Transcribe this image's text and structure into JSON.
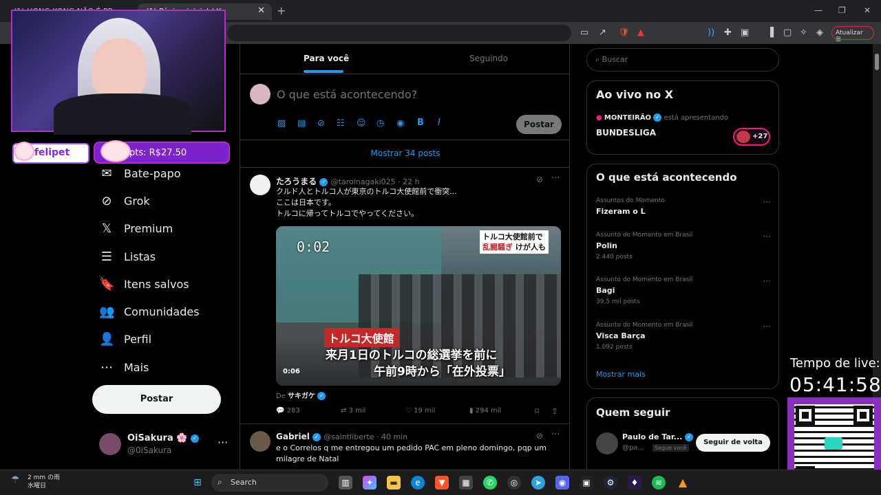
{
  "browser": {
    "tabs": [
      {
        "label": "(1) HONG KONG NÃO É PR..."
      },
      {
        "label": "(1) Página inicial / X"
      }
    ],
    "new_tab": "+",
    "window_controls": {
      "minimize": "—",
      "maximize": "❐",
      "close": "✕"
    },
    "update_button": "Atualizar"
  },
  "stream": {
    "name_badge": "vtfelipet",
    "points_badge": "pts: R$27.50",
    "live_time_label": "Tempo de live:",
    "live_time_value": "05:41:58"
  },
  "nav": {
    "items": [
      {
        "icon": "chat-icon",
        "glyph": "✉",
        "label": "Bate-papo"
      },
      {
        "icon": "grok-icon",
        "glyph": "⊘",
        "label": "Grok"
      },
      {
        "icon": "x-logo-icon",
        "glyph": "𝕏",
        "label": "Premium"
      },
      {
        "icon": "list-icon",
        "glyph": "☰",
        "label": "Listas"
      },
      {
        "icon": "bookmark-icon",
        "glyph": "🔖",
        "label": "Itens salvos"
      },
      {
        "icon": "communities-icon",
        "glyph": "👥",
        "label": "Comunidades"
      },
      {
        "icon": "profile-icon",
        "glyph": "👤",
        "label": "Perfil"
      },
      {
        "icon": "more-icon",
        "glyph": "⋯",
        "label": "Mais"
      }
    ],
    "post_button": "Postar",
    "account": {
      "name": "OiSakura",
      "star": "🌸",
      "handle": "@0iSakura",
      "more": "···"
    }
  },
  "feed": {
    "tabs": [
      {
        "label": "Para você"
      },
      {
        "label": "Seguindo"
      }
    ],
    "composer": {
      "placeholder": "O que está acontecendo?",
      "post_button": "Postar"
    },
    "show_more": "Mostrar 34 posts",
    "tweets": [
      {
        "name": "たろうまる",
        "handle": "@taroinagaki025 · 22 h",
        "lines": [
          "クルド人とトルコ人が東京のトルコ大使館前で衝突...",
          "ここは日本です。",
          "トルコに帰ってトルコでやってください。"
        ],
        "video": {
          "timestamp": "0:02",
          "top_caption_1": "トルコ大使館前で",
          "top_caption_2a": "乱闘騒ぎ",
          "top_caption_2b": " けが人も",
          "caption_red": "トルコ大使館",
          "caption_line1": "来月1日のトルコの総選挙を前に",
          "caption_line2": "午前9時から「在外投票」",
          "duration": "0:06"
        },
        "source_prefix": "De",
        "source_name": "サキガケ",
        "stats": {
          "replies": "283",
          "reposts": "3 mil",
          "likes": "19 mil",
          "views": "294 mil"
        }
      },
      {
        "name": "Gabriel",
        "handle": "@saintliberte · 40 min",
        "lines": [
          "e o Correlos q me entregou um pedido PAC em pleno domingo, pqp um",
          "milagre de Natal"
        ]
      }
    ]
  },
  "sidebar": {
    "search_placeholder": "Buscar",
    "live": {
      "heading": "Ao vivo no X",
      "host": "MONTEIRÃO",
      "host_suffix": "está apresentando",
      "title": "BUNDESLIGA",
      "count": "+27"
    },
    "trends": {
      "heading": "O que está acontecendo",
      "items": [
        {
          "category": "Assuntos do Momento",
          "name": "Fizeram o L",
          "count": ""
        },
        {
          "category": "Assunto do Momento em Brasil",
          "name": "Polin",
          "count": "2.440 posts"
        },
        {
          "category": "Assunto do Momento em Brasil",
          "name": "Bagi",
          "count": "39,5 mil posts"
        },
        {
          "category": "Assunto do Momento em Brasil",
          "name": "Visca Barça",
          "count": "1.092 posts"
        }
      ],
      "show_more": "Mostrar mais"
    },
    "follow": {
      "heading": "Quem seguir",
      "name": "Paulo de Tar...",
      "handle": "@pa...",
      "badge": "Segue você",
      "button": "Seguir de volta"
    }
  },
  "taskbar": {
    "weather_line1": "2 mm の雨",
    "weather_line2": "水曜日",
    "search": "Search"
  },
  "colors": {
    "accent": "#1d9bf0",
    "stream_purple": "#8b2dbf",
    "live_pink": "#f91880"
  }
}
